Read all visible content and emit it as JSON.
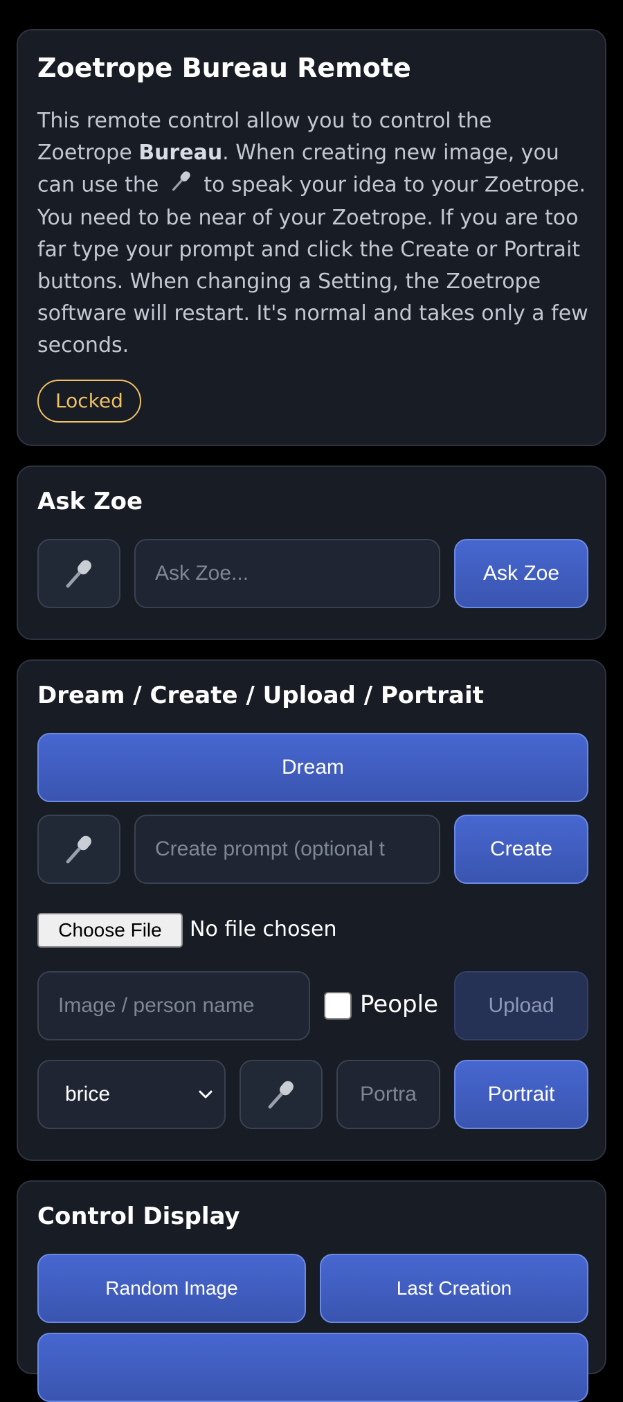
{
  "intro": {
    "title": "Zoetrope Bureau Remote",
    "desc_part1": "This remote control allow you to control the Zoetrope ",
    "desc_bold": "Bureau",
    "desc_part2": ". When creating new image, you can use the ",
    "desc_part3": " to speak your idea to your Zoetrope. You need to be near of your Zoetrope. If you are too far type your prompt and click the Create or Portrait buttons. When changing a Setting, the Zoetrope software will restart. It's normal and takes only a few seconds.",
    "badge": "Locked"
  },
  "ask": {
    "title": "Ask Zoe",
    "placeholder": "Ask Zoe...",
    "button": "Ask Zoe"
  },
  "dream": {
    "title": "Dream / Create / Upload / Portrait",
    "dream_button": "Dream",
    "create_placeholder": "Create prompt (optional t",
    "create_button": "Create",
    "choose_file": "Choose File",
    "no_file": "No file chosen",
    "name_placeholder": "Image / person name",
    "people_label": "People",
    "upload_button": "Upload",
    "person_selected": "brice",
    "portrait_placeholder": "Portra",
    "portrait_button": "Portrait"
  },
  "control": {
    "title": "Control Display",
    "random_button": "Random Image",
    "last_button": "Last Creation"
  },
  "colors": {
    "accent": "#4767d0",
    "badge": "#f0c165",
    "card": "#181c24"
  }
}
